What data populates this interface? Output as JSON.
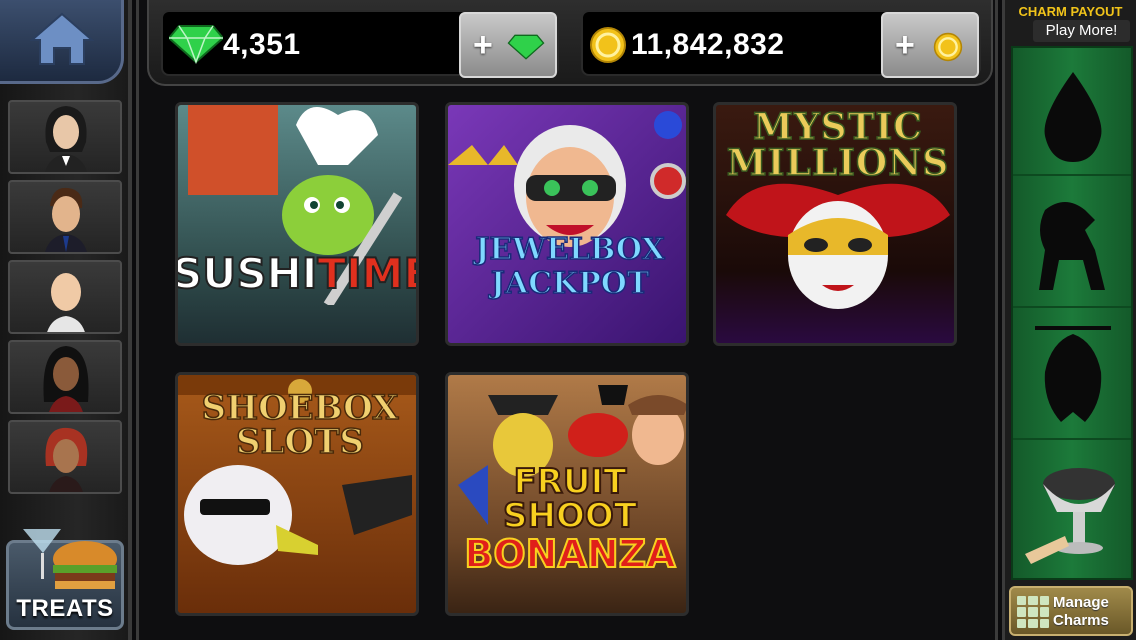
{
  "nav": {
    "home_icon": "home-icon"
  },
  "friends": {
    "avatars": [
      {
        "name": "avatar-long-dark-hair"
      },
      {
        "name": "avatar-brown-hair-suit"
      },
      {
        "name": "avatar-bald"
      },
      {
        "name": "avatar-long-black-hair"
      },
      {
        "name": "avatar-red-hair"
      }
    ]
  },
  "treats": {
    "label": "TREATS"
  },
  "currency": {
    "gems": "4,351",
    "coins": "11,842,832",
    "add_symbol": "+"
  },
  "games": [
    {
      "title_line1": "SUSHI",
      "title_line2": "TIME!"
    },
    {
      "title_line1": "JEWELBOX",
      "title_line2": "JACKPOT"
    },
    {
      "title_line1": "MYSTIC",
      "title_line2": "MILLIONS"
    },
    {
      "title_line1": "SHOEBOX",
      "title_line2": "SLOTS"
    },
    {
      "title_line1": "FRUIT",
      "title_line2": "SHOOT",
      "title_line3": "BONANZA"
    }
  ],
  "charm_panel": {
    "title": "CHARM PAYOUT",
    "play_more": "Play More!",
    "charms": [
      "oil-drop-icon",
      "horse-icon",
      "bat-icon",
      "caviar-icon"
    ],
    "manage_label_1": "Manage",
    "manage_label_2": "Charms"
  },
  "colors": {
    "gem_green": "#2fd14a",
    "coin_gold": "#f2c21a",
    "charm_green": "#1c7a3a",
    "payout_gold": "#f0c31a"
  }
}
